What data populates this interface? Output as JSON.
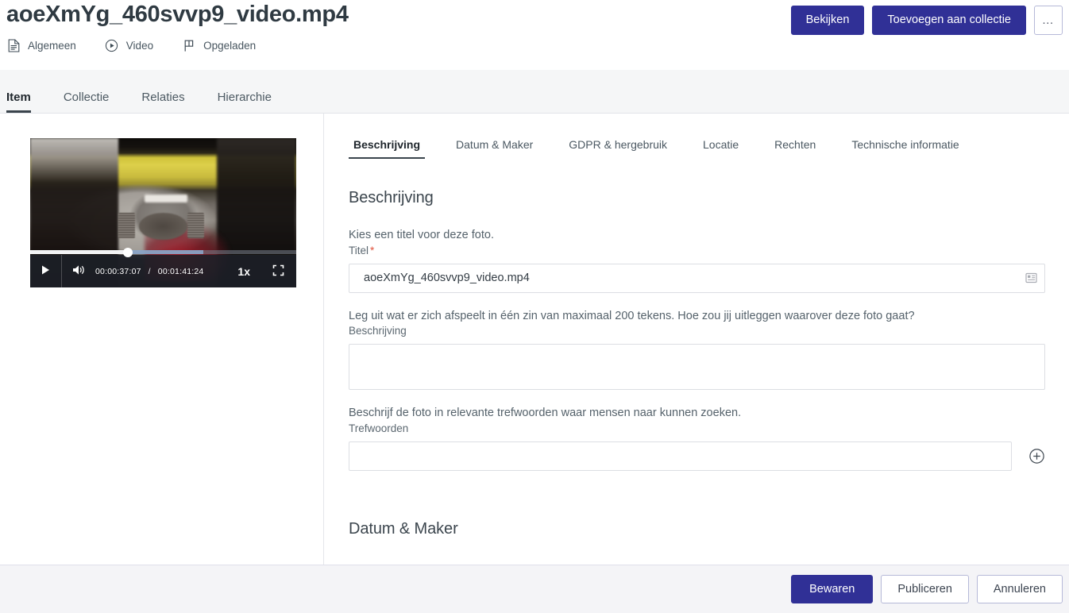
{
  "header": {
    "title": "aoeXmYg_460svvp9_video.mp4",
    "meta": [
      {
        "icon": "document-icon",
        "label": "Algemeen"
      },
      {
        "icon": "play-circle-icon",
        "label": "Video"
      },
      {
        "icon": "flag-icon",
        "label": "Opgeladen"
      }
    ],
    "actions": {
      "view_label": "Bekijken",
      "add_to_collection_label": "Toevoegen aan collectie",
      "more_label": "…"
    }
  },
  "tabs": [
    {
      "label": "Item",
      "active": true
    },
    {
      "label": "Collectie",
      "active": false
    },
    {
      "label": "Relaties",
      "active": false
    },
    {
      "label": "Hierarchie",
      "active": false
    }
  ],
  "player": {
    "play_label": "Afspelen",
    "volume_label": "Volume",
    "current_time": "00:00:37:07",
    "separator": "/",
    "duration": "00:01:41:24",
    "playback_rate": "1x",
    "fullscreen_label": "Volledig scherm",
    "progress_percent": 36.6,
    "buffered_percent": 65
  },
  "subtabs": [
    {
      "label": "Beschrijving",
      "active": true
    },
    {
      "label": "Datum & Maker",
      "active": false
    },
    {
      "label": "GDPR & hergebruik",
      "active": false
    },
    {
      "label": "Locatie",
      "active": false
    },
    {
      "label": "Rechten",
      "active": false
    },
    {
      "label": "Technische informatie",
      "active": false
    }
  ],
  "form": {
    "section_title": "Beschrijving",
    "title_field": {
      "help": "Kies een titel voor deze foto.",
      "label": "Titel",
      "required_marker": "*",
      "value": "aoeXmYg_460svvp9_video.mp4",
      "placeholder": "",
      "affix_icon": "record-list-icon"
    },
    "description_field": {
      "help": "Leg uit wat er zich afspeelt in één zin van maximaal 200 tekens. Hoe zou jij uitleggen waarover deze foto gaat?",
      "label": "Beschrijving",
      "value": "",
      "placeholder": ""
    },
    "keywords_field": {
      "help": "Beschrijf de foto in relevante trefwoorden waar mensen naar kunnen zoeken.",
      "label": "Trefwoorden",
      "value": "",
      "placeholder": "",
      "add_icon": "plus-circle-icon"
    },
    "next_section_title": "Datum & Maker"
  },
  "footer": {
    "save_label": "Bewaren",
    "publish_label": "Publiceren",
    "cancel_label": "Annuleren"
  },
  "colors": {
    "primary": "#303096",
    "required": "#e0533d",
    "tab_underline": "#3a444c",
    "page_bg": "#f4f4f7",
    "tabbar_bg": "#f5f6f7"
  }
}
